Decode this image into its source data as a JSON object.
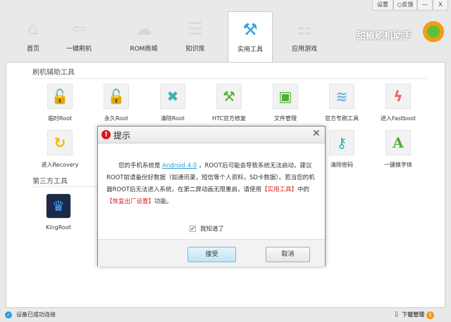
{
  "window": {
    "settings": "设置",
    "feedback": "反馈",
    "minimize": "—",
    "close": "X",
    "brand": "甜椒刷机助手"
  },
  "tabs": [
    {
      "label": "首页",
      "icon": "⌂"
    },
    {
      "label": "一键刷机",
      "icon": "⇦"
    },
    {
      "label": "ROM商城",
      "icon": "☁"
    },
    {
      "label": "知识库",
      "icon": "☰"
    },
    {
      "label": "实用工具",
      "icon": "⚒"
    },
    {
      "label": "应用游戏",
      "icon": "⚏"
    }
  ],
  "sections": {
    "flash_tools": "刷机辅助工具",
    "third_party": "第三方工具"
  },
  "tools": [
    {
      "label": "临时Root",
      "icon": "🔓",
      "color": "#f2b705"
    },
    {
      "label": "永久Root",
      "icon": "🔓",
      "color": "#f08a3c"
    },
    {
      "label": "清除Root",
      "icon": "✖",
      "color": "#3bb3a8"
    },
    {
      "label": "HTC官方修复",
      "icon": "⚒",
      "color": "#4caf30"
    },
    {
      "label": "文件管理",
      "icon": "▣",
      "color": "#4caf30"
    },
    {
      "label": "官方专刷工具",
      "icon": "≋",
      "color": "#6bb6e0"
    },
    {
      "label": "进入Fastboot",
      "icon": "ϟ",
      "color": "#f06060"
    },
    {
      "label": "进入Recovery",
      "icon": "↻",
      "color": "#f2b705"
    },
    {
      "label": "清除密码",
      "icon": "⚷",
      "color": "#2ab0b0"
    },
    {
      "label": "一键换字体",
      "icon": "A",
      "color": "#4caf30"
    }
  ],
  "third_party_tools": [
    {
      "label": "KingRoot"
    }
  ],
  "dialog": {
    "title": "提示",
    "close": "✕",
    "text_1": "您的手机系统是 ",
    "link": "Android 4.0",
    "text_2": " ，ROOT后可能会导致系统无法启动，建议ROOT前请备份好数据（如通讯录，短信等个人资料，SD卡数据）。若当您的机器ROOT后无法进入系统，在第二屏动画无限重启，请使用",
    "hl_1": "【实用工具】",
    "text_3": "中的",
    "hl_2": "【恢复出厂设置】",
    "text_4": "功能。",
    "checkbox_label": "我知道了",
    "checkbox_checked": true,
    "accept": "接受",
    "cancel": "取消"
  },
  "status": {
    "connection": "设备已成功连接",
    "download_manager": "下载管理",
    "download_count": "1"
  }
}
